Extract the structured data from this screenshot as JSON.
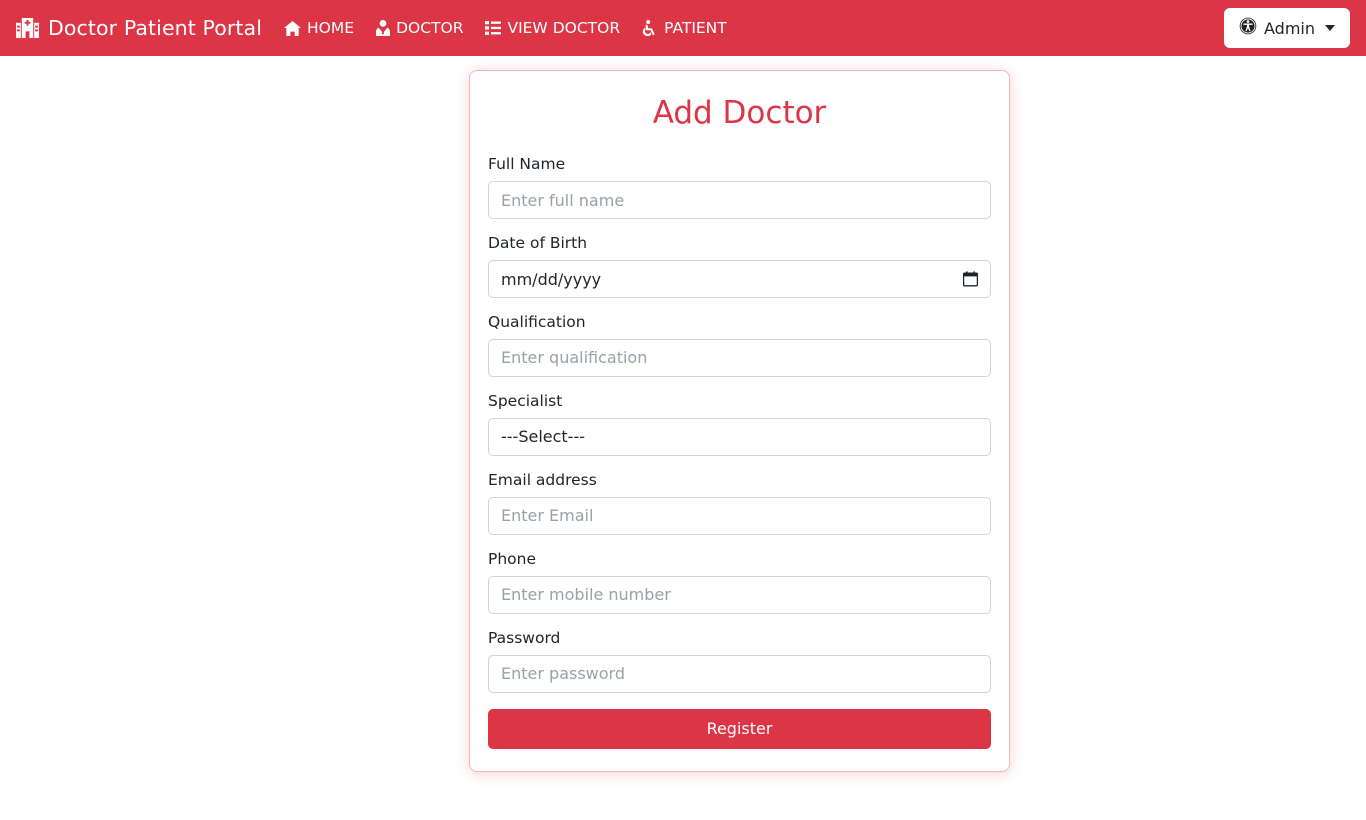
{
  "navbar": {
    "background_color": "#dc3545",
    "brand": {
      "text": "Doctor Patient Portal",
      "icon": "hospital-icon"
    },
    "links": [
      {
        "label": "HOME",
        "icon": "home-icon"
      },
      {
        "label": "DOCTOR",
        "icon": "user-md-icon"
      },
      {
        "label": "VIEW DOCTOR",
        "icon": "list-icon"
      },
      {
        "label": "PATIENT",
        "icon": "wheelchair-icon"
      }
    ],
    "account": {
      "label": "Admin",
      "icon": "universal-access-icon",
      "caret": "chevron-down-icon"
    }
  },
  "card": {
    "title": "Add Doctor",
    "title_color": "#dc3545",
    "border_color": "#eeb8bd",
    "fields": [
      {
        "label": "Full Name",
        "placeholder": "Enter full name",
        "type": "text",
        "value": ""
      },
      {
        "label": "Date of Birth",
        "placeholder": "mm/dd/yyyy",
        "type": "date",
        "value": ""
      },
      {
        "label": "Qualification",
        "placeholder": "Enter qualification",
        "type": "text",
        "value": ""
      },
      {
        "label": "Specialist",
        "placeholder": "---Select---",
        "type": "select",
        "value": "---Select---"
      },
      {
        "label": "Email address",
        "placeholder": "Enter Email",
        "type": "email",
        "value": ""
      },
      {
        "label": "Phone",
        "placeholder": "Enter mobile number",
        "type": "tel",
        "value": ""
      },
      {
        "label": "Password",
        "placeholder": "Enter password",
        "type": "password",
        "value": ""
      }
    ],
    "submit": {
      "label": "Register",
      "color": "#dc3545"
    }
  }
}
